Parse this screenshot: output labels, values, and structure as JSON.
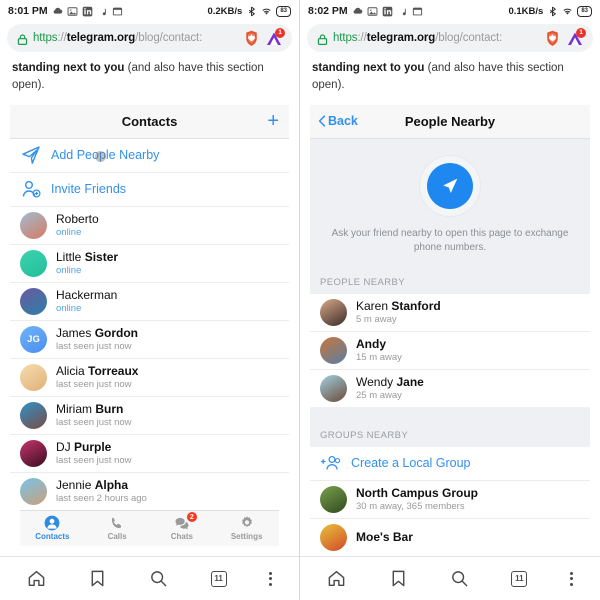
{
  "left": {
    "statusbar": {
      "time": "8:01 PM",
      "icons": [
        "cloud-icon",
        "gallery-icon",
        "linkedin-icon",
        "music-icon",
        "screenshot-icon"
      ],
      "net_speed": "0.2KB/s",
      "right_icons": [
        "bluetooth-icon",
        "wifi-icon"
      ],
      "battery": "83"
    },
    "urlbar": {
      "scheme": "https",
      "separator": "://",
      "host": "telegram.org",
      "path": "/blog/contact:",
      "lock": "lock-icon",
      "shield": "brave-shield-icon",
      "extension_badge": "1"
    },
    "blog": {
      "bold_lead": "standing next to you",
      "rest": " (and also have this section open)."
    },
    "card": {
      "title": "Contacts",
      "add_label": "+",
      "actions": [
        {
          "label": "Add People Nearby",
          "icon": "paper-plane-icon"
        },
        {
          "label": "Invite Friends",
          "icon": "add-person-icon"
        }
      ],
      "contacts": [
        {
          "first": "Roberto",
          "last": "",
          "status": "online",
          "online": true,
          "avatar_type": "photo",
          "c1": "#d77a63",
          "c2": "#9fbcd0"
        },
        {
          "first": "Little ",
          "last": "Sister",
          "status": "online",
          "online": true,
          "avatar_type": "photo",
          "c1": "#1fbf9a",
          "c2": "#3fd2b0"
        },
        {
          "first": "Hackerman",
          "last": "",
          "status": "online",
          "online": true,
          "avatar_type": "photo",
          "c1": "#4a3f72",
          "c2": "#2e7fa8"
        },
        {
          "first": "James ",
          "last": "Gordon",
          "status": "last seen just now",
          "online": false,
          "avatar_type": "initials",
          "initials": "JG",
          "c1": "#5fa8f5",
          "c2": "#4b8ef0"
        },
        {
          "first": "Alicia ",
          "last": "Torreaux",
          "status": "last seen just now",
          "online": false,
          "avatar_type": "photo",
          "c1": "#f0cf9a",
          "c2": "#e0b077"
        },
        {
          "first": "Miriam ",
          "last": "Burn",
          "status": "last seen just now",
          "online": false,
          "avatar_type": "photo",
          "c1": "#2f93c8",
          "c2": "#7c4a45"
        },
        {
          "first": "DJ ",
          "last": "Purple",
          "status": "last seen just now",
          "online": false,
          "avatar_type": "photo",
          "c1": "#c7356f",
          "c2": "#5a1230"
        },
        {
          "first": "Jennie ",
          "last": "Alpha",
          "status": "last seen 2 hours ago",
          "online": false,
          "avatar_type": "photo",
          "c1": "#79c3e8",
          "c2": "#c9a07b"
        }
      ],
      "tabs": [
        {
          "label": "Contacts",
          "icon": "contacts-icon",
          "active": true,
          "badge": ""
        },
        {
          "label": "Calls",
          "icon": "phone-icon",
          "active": false,
          "badge": ""
        },
        {
          "label": "Chats",
          "icon": "chat-bubbles-icon",
          "active": false,
          "badge": "2"
        },
        {
          "label": "Settings",
          "icon": "gear-icon",
          "active": false,
          "badge": ""
        }
      ]
    }
  },
  "right": {
    "statusbar": {
      "time": "8:02 PM",
      "net_speed": "0.1KB/s",
      "battery": "83"
    },
    "urlbar": {
      "scheme": "https",
      "separator": "://",
      "host": "telegram.org",
      "path": "/blog/contact:",
      "extension_badge": "1"
    },
    "blog": {
      "bold_lead": "standing next to you",
      "rest": " (and also have this section open)."
    },
    "card": {
      "back_label": "Back",
      "title": "People Nearby",
      "hero_icon": "location-arrow-icon",
      "hero_caption": "Ask your friend nearby to open this page to exchange phone numbers.",
      "people_section": "PEOPLE NEARBY",
      "people": [
        {
          "first": "Karen ",
          "last": "Stanford",
          "sub": "5 m away",
          "c1": "#3b2c28",
          "c2": "#d9a88a"
        },
        {
          "first": "Andy",
          "last": "",
          "sub": "15 m away",
          "c1": "#c8763f",
          "c2": "#5a7fa0"
        },
        {
          "first": "Wendy ",
          "last": "Jane",
          "sub": "25 m away",
          "c1": "#9fd0e0",
          "c2": "#6d4a3a"
        }
      ],
      "groups_section": "GROUPS NEARBY",
      "create_group_label": "Create a Local Group",
      "create_group_icon": "add-group-icon",
      "groups": [
        {
          "name": "North Campus Group",
          "sub": "30 m away, 365 members",
          "c1": "#5b7b3a",
          "c2": "#2f4a1e"
        },
        {
          "name": "Moe's Bar",
          "sub": "",
          "c1": "#e8c23a",
          "c2": "#d04a2a"
        }
      ]
    }
  },
  "bottomnav": {
    "items": [
      {
        "icon": "home-icon",
        "label": ""
      },
      {
        "icon": "bookmark-icon",
        "label": ""
      },
      {
        "icon": "search-icon",
        "label": ""
      },
      {
        "icon": "tab-count-icon",
        "label": "11"
      },
      {
        "icon": "overflow-menu-icon",
        "label": ""
      }
    ]
  },
  "colors": {
    "accent": "#3390ec",
    "badge_red": "#f6391f",
    "green_lock": "#1a9b4b",
    "panel_bg": "#eef0f3"
  }
}
